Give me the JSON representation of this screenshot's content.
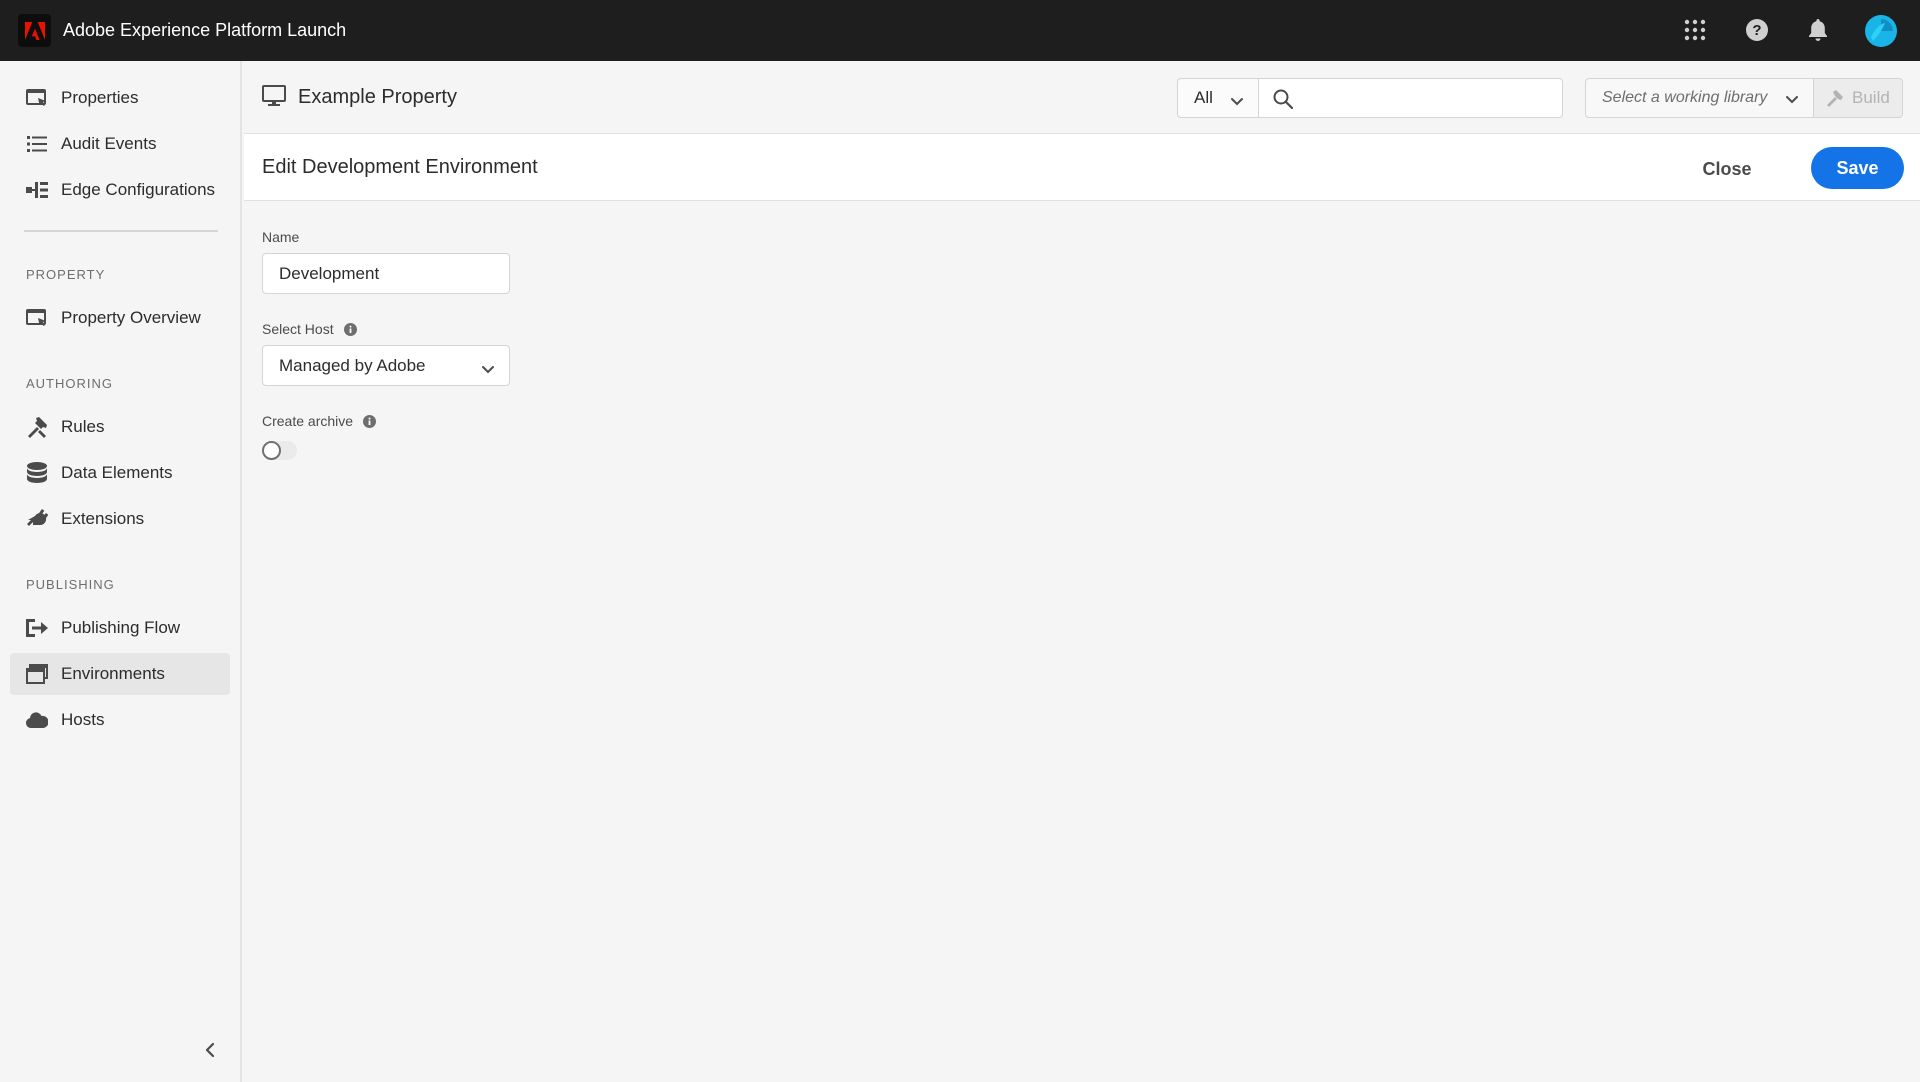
{
  "app": {
    "title": "Adobe Experience Platform Launch"
  },
  "sidebar": {
    "top_items": [
      {
        "label": "Properties",
        "icon": "properties-icon"
      },
      {
        "label": "Audit Events",
        "icon": "list-icon"
      },
      {
        "label": "Edge Configurations",
        "icon": "edge-config-icon"
      }
    ],
    "sections": [
      {
        "header": "PROPERTY",
        "items": [
          {
            "label": "Property Overview",
            "icon": "properties-icon"
          }
        ]
      },
      {
        "header": "AUTHORING",
        "items": [
          {
            "label": "Rules",
            "icon": "rules-icon"
          },
          {
            "label": "Data Elements",
            "icon": "database-icon"
          },
          {
            "label": "Extensions",
            "icon": "plug-icon"
          }
        ]
      },
      {
        "header": "PUBLISHING",
        "items": [
          {
            "label": "Publishing Flow",
            "icon": "publishing-flow-icon"
          },
          {
            "label": "Environments",
            "icon": "environments-icon",
            "active": true
          },
          {
            "label": "Hosts",
            "icon": "cloud-icon"
          }
        ]
      }
    ]
  },
  "header": {
    "property_name": "Example Property",
    "scope_value": "All",
    "search_placeholder": "",
    "library_placeholder": "Select a working library",
    "build_label": "Build"
  },
  "edit": {
    "title": "Edit Development Environment",
    "close_label": "Close",
    "save_label": "Save"
  },
  "form": {
    "name_label": "Name",
    "name_value": "Development",
    "host_label": "Select Host",
    "host_value": "Managed by Adobe",
    "archive_label": "Create archive",
    "archive_enabled": false
  },
  "colors": {
    "topbar": "#1e1e1e",
    "accent": "#1473e6",
    "adobe_red": "#eb1000",
    "avatar": "#1ab5e8"
  }
}
